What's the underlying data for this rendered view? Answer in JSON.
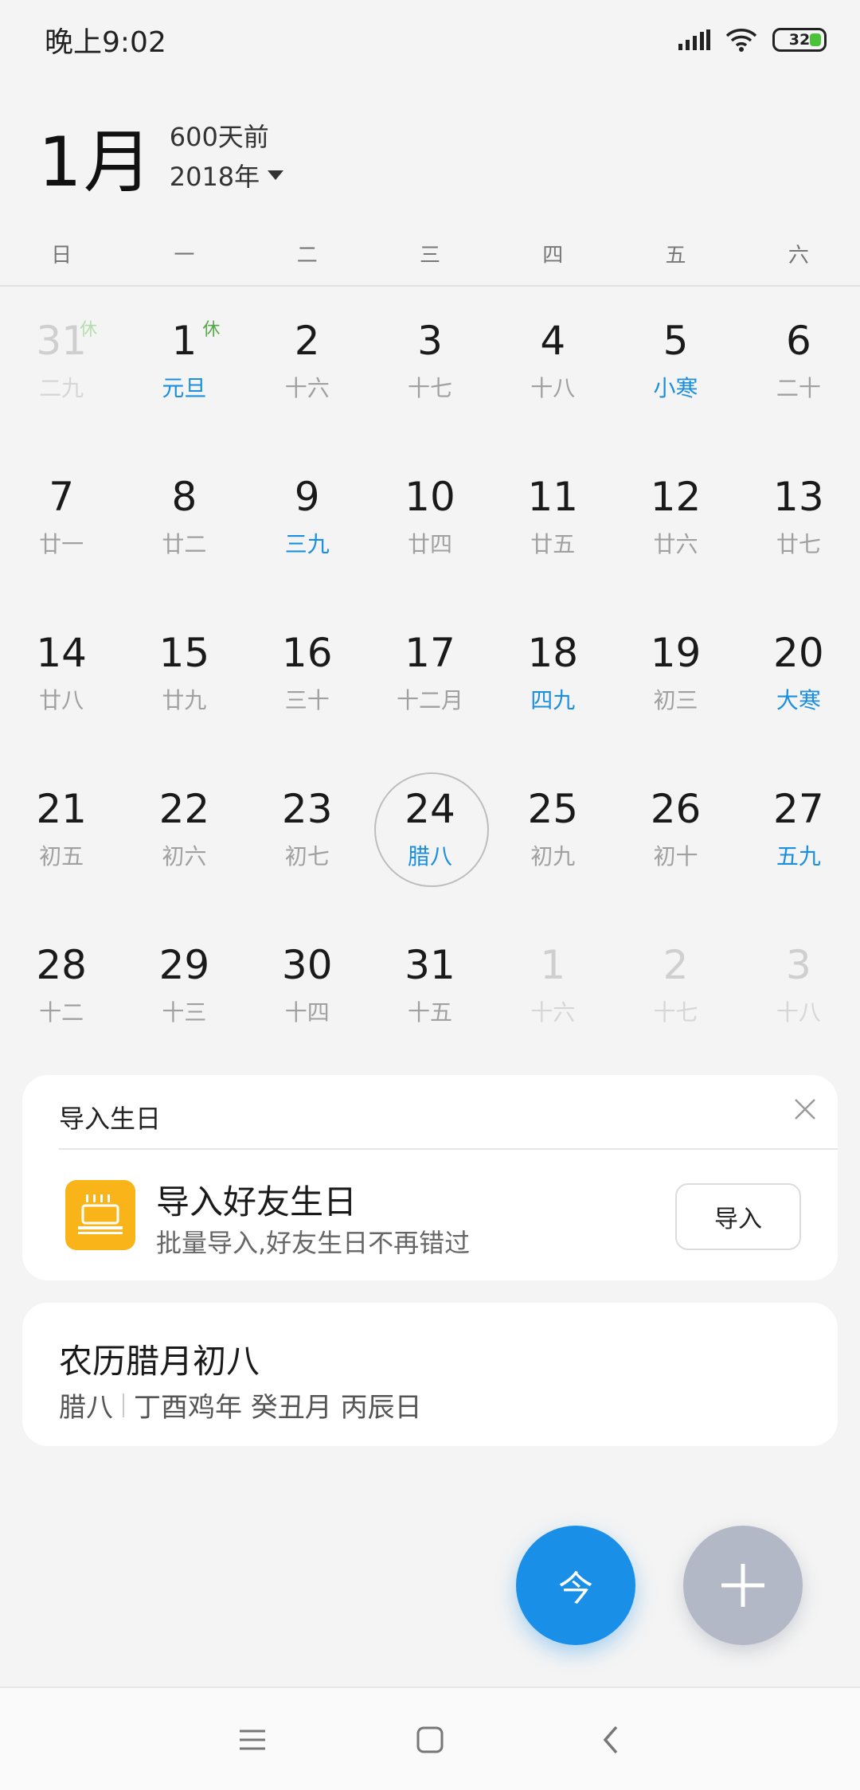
{
  "status_bar": {
    "time": "晚上9:02",
    "battery": "32"
  },
  "header": {
    "month": "1月",
    "days_ago": "600天前",
    "year": "2018年"
  },
  "weekdays": [
    "日",
    "一",
    "二",
    "三",
    "四",
    "五",
    "六"
  ],
  "calendar": {
    "holiday_tag": "休",
    "days": [
      {
        "num": "31",
        "sub": "二九",
        "faded": true,
        "tag": "休"
      },
      {
        "num": "1",
        "sub": "元旦",
        "hl": true,
        "tag": "休"
      },
      {
        "num": "2",
        "sub": "十六"
      },
      {
        "num": "3",
        "sub": "十七"
      },
      {
        "num": "4",
        "sub": "十八"
      },
      {
        "num": "5",
        "sub": "小寒",
        "hl": true
      },
      {
        "num": "6",
        "sub": "二十"
      },
      {
        "num": "7",
        "sub": "廿一"
      },
      {
        "num": "8",
        "sub": "廿二"
      },
      {
        "num": "9",
        "sub": "三九",
        "hl": true
      },
      {
        "num": "10",
        "sub": "廿四"
      },
      {
        "num": "11",
        "sub": "廿五"
      },
      {
        "num": "12",
        "sub": "廿六"
      },
      {
        "num": "13",
        "sub": "廿七"
      },
      {
        "num": "14",
        "sub": "廿八"
      },
      {
        "num": "15",
        "sub": "廿九"
      },
      {
        "num": "16",
        "sub": "三十"
      },
      {
        "num": "17",
        "sub": "十二月"
      },
      {
        "num": "18",
        "sub": "四九",
        "hl": true
      },
      {
        "num": "19",
        "sub": "初三"
      },
      {
        "num": "20",
        "sub": "大寒",
        "hl": true
      },
      {
        "num": "21",
        "sub": "初五"
      },
      {
        "num": "22",
        "sub": "初六"
      },
      {
        "num": "23",
        "sub": "初七"
      },
      {
        "num": "24",
        "sub": "腊八",
        "hl": true,
        "today": true
      },
      {
        "num": "25",
        "sub": "初九"
      },
      {
        "num": "26",
        "sub": "初十"
      },
      {
        "num": "27",
        "sub": "五九",
        "hl": true
      },
      {
        "num": "28",
        "sub": "十二"
      },
      {
        "num": "29",
        "sub": "十三"
      },
      {
        "num": "30",
        "sub": "十四"
      },
      {
        "num": "31",
        "sub": "十五"
      },
      {
        "num": "1",
        "sub": "十六",
        "faded": true
      },
      {
        "num": "2",
        "sub": "十七",
        "faded": true
      },
      {
        "num": "3",
        "sub": "十八",
        "faded": true
      }
    ]
  },
  "import_card": {
    "title": "导入生日",
    "main": "导入好友生日",
    "sub": "批量导入,好友生日不再错过",
    "button": "导入"
  },
  "lunar_card": {
    "title": "农历腊月初八",
    "festival": "腊八",
    "ganzhi": "丁酉鸡年 癸丑月 丙辰日"
  },
  "fab": {
    "today_label": "今"
  },
  "colors": {
    "accent": "#1a8fe0",
    "holiday_green": "#57a84a",
    "cake_bg": "#f8b418",
    "fab_blue": "#1a8fe8",
    "fab_grey": "#b2b8c6"
  },
  "icons": [
    "signal-icon",
    "wifi-icon",
    "battery-icon",
    "caret-down-icon",
    "close-icon",
    "cake-icon",
    "plus-icon",
    "menu-icon",
    "home-icon",
    "back-icon"
  ]
}
